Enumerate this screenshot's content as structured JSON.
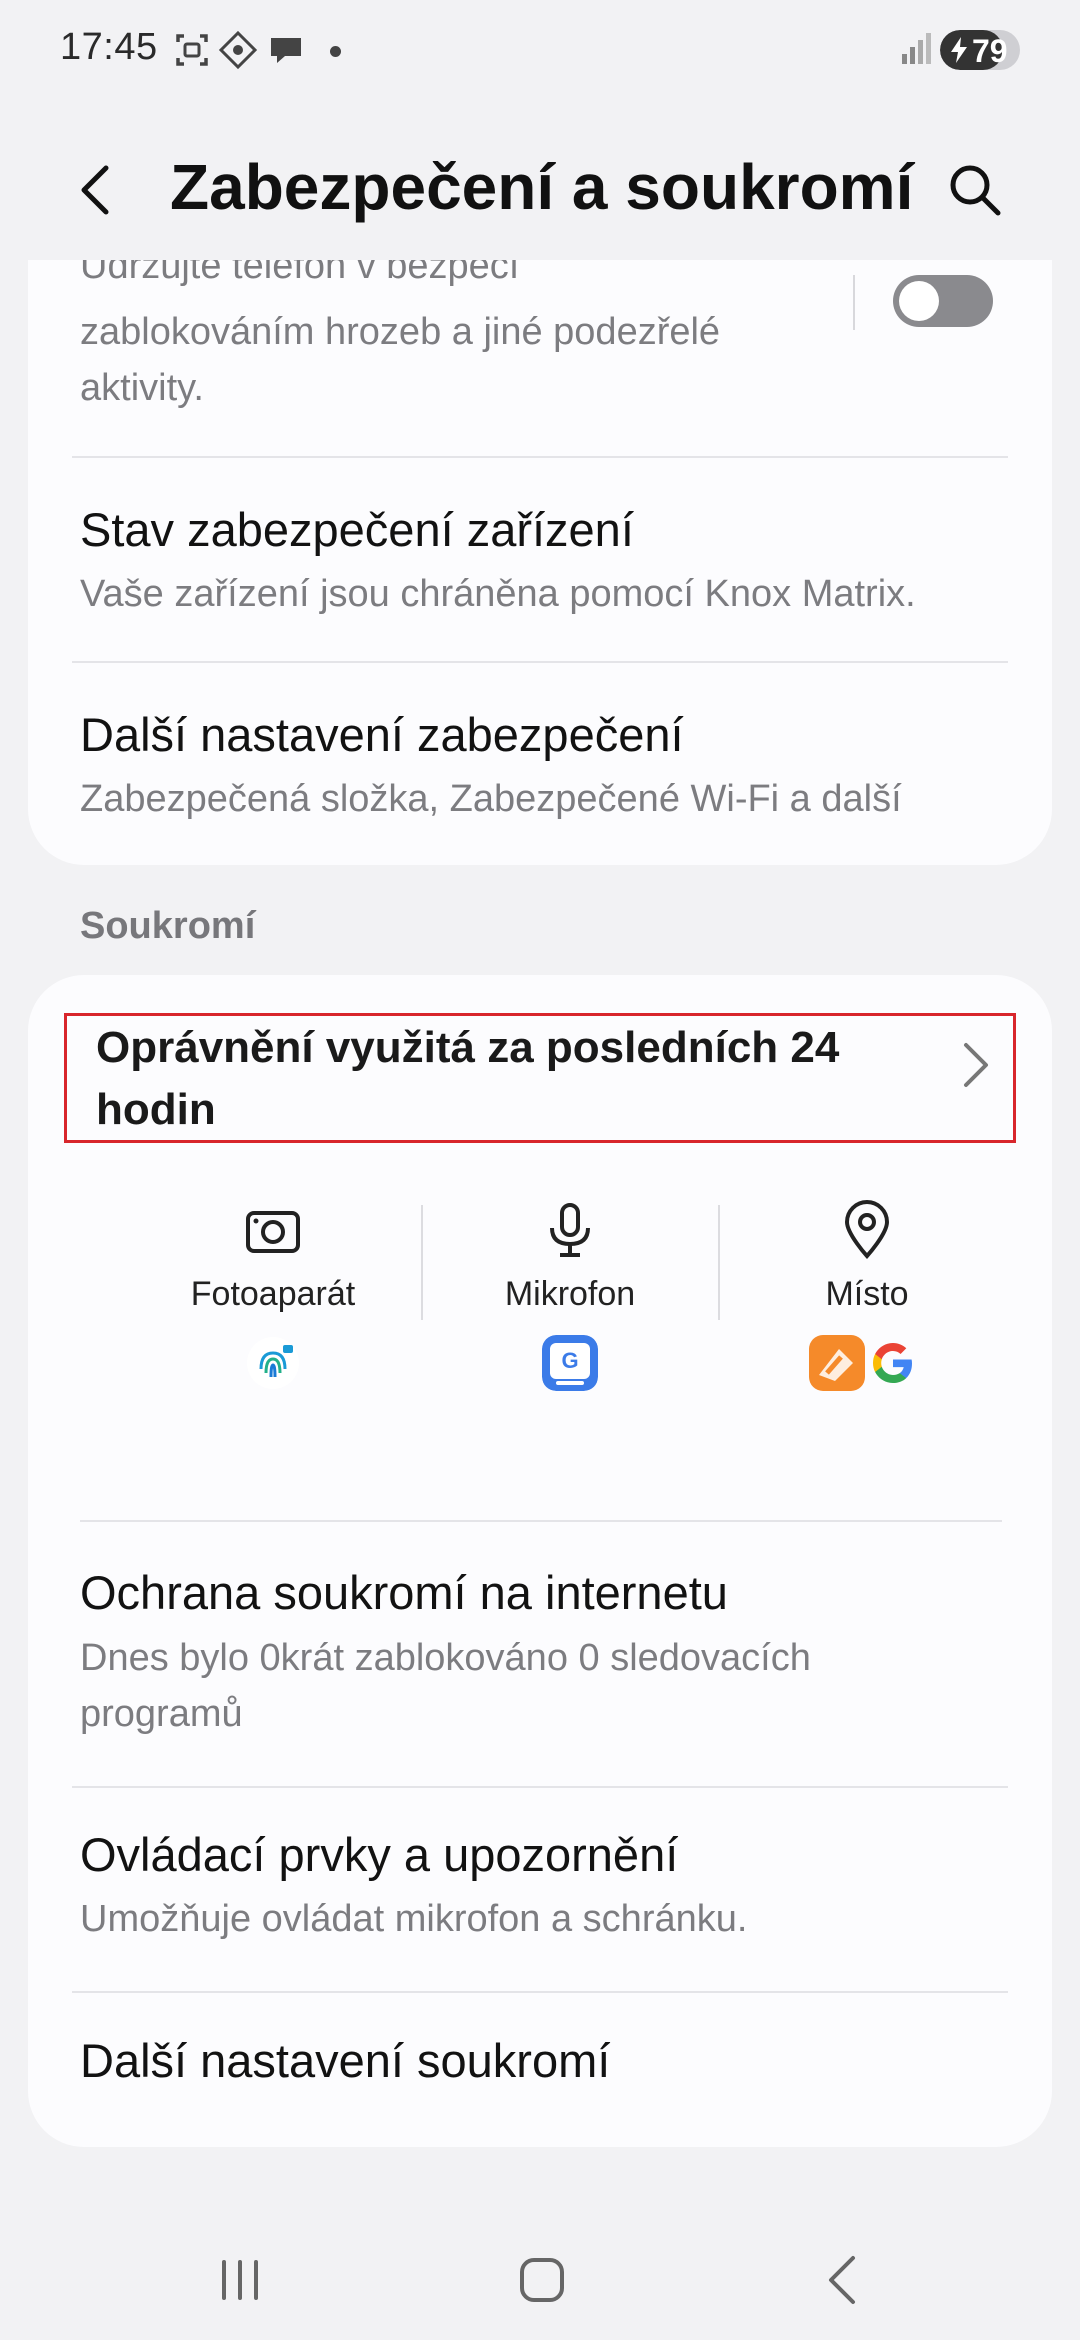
{
  "status_bar": {
    "time": "17:45",
    "battery": "79",
    "battery_level": 0.79,
    "icons": [
      "screenshot-icon",
      "vpn-icon",
      "chat-icon",
      "notification-dot",
      "signal-icon",
      "battery-icon"
    ]
  },
  "header": {
    "title": "Zabezpečení a soukromí",
    "back_icon": "back-arrow-icon",
    "search_icon": "search-icon"
  },
  "security_card": {
    "auto_blocker": {
      "partial_title": "Udržujte telefon v bezpečí",
      "subtitle": "zablokováním hrozeb a jiné podezřelé aktivity.",
      "toggle_on": false
    },
    "items": [
      {
        "title": "Stav zabezpečení zařízení",
        "subtitle": "Vaše zařízení jsou chráněna pomocí Knox Matrix."
      },
      {
        "title": "Další nastavení zabezpečení",
        "subtitle": "Zabezpečená složka, Zabezpečené Wi-Fi a další"
      }
    ]
  },
  "privacy_section": {
    "label": "Soukromí",
    "permissions": {
      "title": "Oprávnění využitá za posledních 24 hodin",
      "columns": [
        {
          "label": "Fotoaparát",
          "icon": "camera-icon",
          "apps": [
            "fingerprint-app-icon"
          ]
        },
        {
          "label": "Mikrofon",
          "icon": "microphone-icon",
          "apps": [
            "gboard-app-icon"
          ]
        },
        {
          "label": "Místo",
          "icon": "location-pin-icon",
          "apps": [
            "orange-app-icon",
            "google-icon"
          ]
        }
      ]
    },
    "items": [
      {
        "title": "Ochrana soukromí na internetu",
        "subtitle": "Dnes bylo 0krát zablokováno 0 sledovacích programů"
      },
      {
        "title": "Ovládací prvky a upozornění",
        "subtitle": "Umožňuje ovládat mikrofon a schránku."
      },
      {
        "title": "Další nastavení soukromí",
        "subtitle": ""
      }
    ]
  },
  "nav_bar": {
    "recents_icon": "recents-icon",
    "home_icon": "home-icon",
    "back_icon": "nav-back-icon"
  },
  "colors": {
    "background": "#f2f2f4",
    "card": "#fcfcfe",
    "highlight_border": "#d8262c",
    "secondary_text": "#7c7c80"
  }
}
